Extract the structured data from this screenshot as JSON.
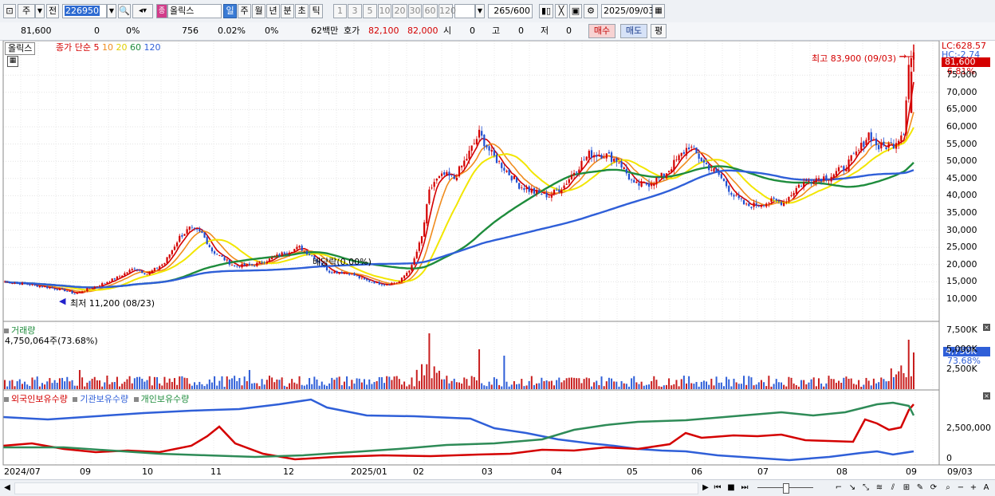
{
  "toolbar": {
    "market_label": "주",
    "prev_label": "전",
    "stock_code": "226950",
    "stock_name": "올릭스",
    "stock_badge": "종",
    "period_buttons": [
      "일",
      "주",
      "월",
      "년",
      "분",
      "초",
      "틱"
    ],
    "period_selected": "일",
    "interval_buttons": [
      "1",
      "3",
      "5",
      "10",
      "20",
      "30",
      "60",
      "120"
    ],
    "count_value": "265",
    "count_total": "/600",
    "date_value": "2025/09/03"
  },
  "quote": {
    "price": "81,600",
    "change": "0",
    "change_pct": "0%",
    "volume": "756",
    "volume_pct": "0.02%",
    "other_pct": "0%",
    "amount": "62백만",
    "ask_label": "호가",
    "ask1": "82,100",
    "ask2": "82,000",
    "open_label": "시",
    "open_value": "0",
    "high_label": "고",
    "high_value": "0",
    "low_label": "저",
    "low_value": "0",
    "buy_button": "매수",
    "sell_button": "매도",
    "eval_button": "평"
  },
  "price_panel": {
    "legend_name": "올릭스",
    "legend_ma_label": "종가 단순",
    "ma_labels": [
      "5",
      "10",
      "20",
      "60",
      "120"
    ],
    "ma_colors": [
      "#d40000",
      "#f08c1e",
      "#f2e600",
      "#1e8c3c",
      "#2f5fd8"
    ],
    "high_annotation": "최고 83,900 (09/03)",
    "low_annotation": "최저 11,200 (08/23)",
    "event_annotation": "배당락(0.00%)",
    "lc_label": "LC:628.57",
    "hc_label": "HC:-2.74",
    "last_price_tag": "81,600",
    "last_pct_tag": "6.81%",
    "y_ticks": [
      "75,000",
      "70,000",
      "65,000",
      "60,000",
      "55,000",
      "50,000",
      "45,000",
      "40,000",
      "35,000",
      "30,000",
      "25,000",
      "20,000",
      "15,000",
      "10,000"
    ]
  },
  "volume_panel": {
    "title": "거래량",
    "value_label": "4,750,064주(73.68%)",
    "y_ticks": [
      "7,500K",
      "5,000K",
      "2,500K"
    ],
    "last_tag": "4,750K",
    "last_pct": "73.68%"
  },
  "holding_panel": {
    "legends": [
      "외국인보유수량",
      "기관보유수량",
      "개인보유수량"
    ],
    "legend_colors": [
      "#d40000",
      "#2f5fd8",
      "#1e8c3c"
    ],
    "y_ticks": [
      "2,500,000",
      "0"
    ]
  },
  "x_axis": {
    "labels": [
      "2024/07",
      "09",
      "10",
      "11",
      "12",
      "2025/01",
      "02",
      "03",
      "04",
      "05",
      "06",
      "07",
      "08",
      "09"
    ],
    "right_label": "09/03"
  },
  "chart_data": {
    "type": "candlestick",
    "y_unit": "KRW",
    "ylim": [
      8000,
      85000
    ],
    "anchors": [
      [
        0,
        15000
      ],
      [
        10,
        14200
      ],
      [
        17,
        13400
      ],
      [
        24,
        12500
      ],
      [
        28,
        11500
      ],
      [
        32,
        12600
      ],
      [
        37,
        13800
      ],
      [
        45,
        16200
      ],
      [
        52,
        19000
      ],
      [
        57,
        17200
      ],
      [
        64,
        20500
      ],
      [
        70,
        28000
      ],
      [
        74,
        30500
      ],
      [
        79,
        29000
      ],
      [
        83,
        24000
      ],
      [
        92,
        19500
      ],
      [
        100,
        20000
      ],
      [
        106,
        21500
      ],
      [
        112,
        23500
      ],
      [
        118,
        25000
      ],
      [
        124,
        22000
      ],
      [
        130,
        18000
      ],
      [
        138,
        17500
      ],
      [
        144,
        15500
      ],
      [
        152,
        14200
      ],
      [
        158,
        15000
      ],
      [
        163,
        19500
      ],
      [
        167,
        28000
      ],
      [
        170,
        41000
      ],
      [
        172,
        44000
      ],
      [
        176,
        46000
      ],
      [
        180,
        45000
      ],
      [
        185,
        51000
      ],
      [
        190,
        58000
      ],
      [
        195,
        52000
      ],
      [
        200,
        48000
      ],
      [
        206,
        43000
      ],
      [
        212,
        41000
      ],
      [
        218,
        40000
      ],
      [
        224,
        43000
      ],
      [
        228,
        47000
      ],
      [
        234,
        52000
      ],
      [
        240,
        52000
      ],
      [
        246,
        50000
      ],
      [
        252,
        43000
      ],
      [
        258,
        43500
      ],
      [
        264,
        46000
      ],
      [
        270,
        51000
      ],
      [
        274,
        54500
      ],
      [
        280,
        49500
      ],
      [
        286,
        46000
      ],
      [
        292,
        40000
      ],
      [
        297,
        37000
      ],
      [
        302,
        37500
      ],
      [
        308,
        38500
      ],
      [
        312,
        38000
      ],
      [
        318,
        43000
      ],
      [
        324,
        45000
      ],
      [
        330,
        45500
      ],
      [
        336,
        48000
      ],
      [
        342,
        53000
      ],
      [
        346,
        58000
      ],
      [
        350,
        54000
      ],
      [
        356,
        55000
      ],
      [
        360,
        59000
      ],
      [
        362,
        78000
      ],
      [
        364,
        81600
      ]
    ],
    "foreign_holding_path": "red",
    "institution_holding_path": "blue",
    "individual_holding_path": "green"
  }
}
